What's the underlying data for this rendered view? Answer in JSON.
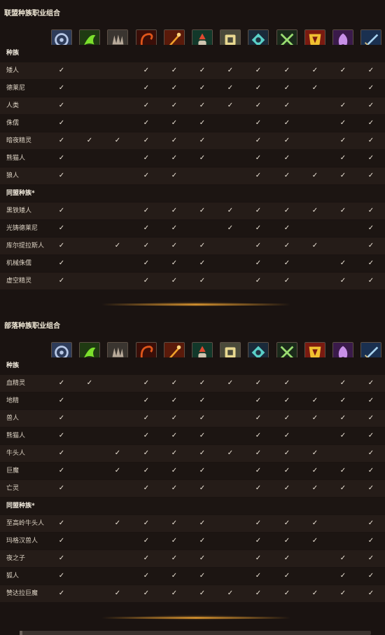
{
  "alliance": {
    "title": "联盟种族职业组合",
    "column_header": "种族",
    "allied_header": "同盟种族*",
    "races": [
      {
        "name": "矮人",
        "checks": [
          1,
          0,
          0,
          1,
          1,
          1,
          1,
          1,
          1,
          1,
          1,
          1
        ]
      },
      {
        "name": "德莱尼",
        "checks": [
          1,
          0,
          0,
          1,
          1,
          1,
          1,
          1,
          1,
          1,
          0,
          1
        ]
      },
      {
        "name": "人类",
        "checks": [
          1,
          0,
          0,
          1,
          1,
          1,
          1,
          1,
          1,
          0,
          1,
          1
        ]
      },
      {
        "name": "侏儒",
        "checks": [
          1,
          0,
          0,
          1,
          1,
          1,
          0,
          1,
          1,
          0,
          1,
          1
        ]
      },
      {
        "name": "暗夜精灵",
        "checks": [
          1,
          1,
          1,
          1,
          1,
          1,
          0,
          1,
          1,
          0,
          1,
          1
        ]
      },
      {
        "name": "熊猫人",
        "checks": [
          1,
          0,
          0,
          1,
          1,
          1,
          0,
          1,
          1,
          0,
          1,
          1
        ]
      },
      {
        "name": "狼人",
        "checks": [
          1,
          0,
          0,
          1,
          1,
          0,
          0,
          1,
          1,
          1,
          1,
          1
        ]
      }
    ],
    "allied_races": [
      {
        "name": "黑铁矮人",
        "checks": [
          1,
          0,
          0,
          1,
          1,
          1,
          1,
          1,
          1,
          1,
          1,
          1
        ]
      },
      {
        "name": "光铸德莱尼",
        "checks": [
          1,
          0,
          0,
          1,
          1,
          0,
          1,
          1,
          1,
          0,
          0,
          1
        ]
      },
      {
        "name": "库尔提拉斯人",
        "checks": [
          1,
          0,
          1,
          1,
          1,
          1,
          0,
          1,
          1,
          1,
          0,
          1
        ]
      },
      {
        "name": "机械侏儒",
        "checks": [
          1,
          0,
          0,
          1,
          1,
          1,
          0,
          1,
          1,
          0,
          1,
          1
        ]
      },
      {
        "name": "虚空精灵",
        "checks": [
          1,
          0,
          0,
          1,
          1,
          1,
          0,
          1,
          1,
          0,
          1,
          1
        ]
      }
    ]
  },
  "horde": {
    "title": "部落种族职业组合",
    "column_header": "种族",
    "allied_header": "同盟种族*",
    "races": [
      {
        "name": "血精灵",
        "checks": [
          1,
          1,
          0,
          1,
          1,
          1,
          1,
          1,
          1,
          0,
          1,
          1
        ]
      },
      {
        "name": "地精",
        "checks": [
          1,
          0,
          0,
          1,
          1,
          1,
          0,
          1,
          1,
          1,
          1,
          1
        ]
      },
      {
        "name": "兽人",
        "checks": [
          1,
          0,
          0,
          1,
          1,
          1,
          0,
          1,
          1,
          1,
          1,
          1
        ]
      },
      {
        "name": "熊猫人",
        "checks": [
          1,
          0,
          0,
          1,
          1,
          1,
          0,
          1,
          1,
          0,
          1,
          1
        ]
      },
      {
        "name": "牛头人",
        "checks": [
          1,
          0,
          1,
          1,
          1,
          1,
          1,
          1,
          1,
          1,
          0,
          1
        ]
      },
      {
        "name": "巨魔",
        "checks": [
          1,
          0,
          1,
          1,
          1,
          1,
          0,
          1,
          1,
          1,
          1,
          1
        ]
      },
      {
        "name": "亡灵",
        "checks": [
          1,
          0,
          0,
          1,
          1,
          1,
          0,
          1,
          1,
          1,
          1,
          1
        ]
      }
    ],
    "allied_races": [
      {
        "name": "至高岭牛头人",
        "checks": [
          1,
          0,
          1,
          1,
          1,
          1,
          0,
          1,
          1,
          1,
          0,
          1
        ]
      },
      {
        "name": "玛格汉兽人",
        "checks": [
          1,
          0,
          0,
          1,
          1,
          1,
          0,
          1,
          1,
          1,
          0,
          1
        ]
      },
      {
        "name": "夜之子",
        "checks": [
          1,
          0,
          0,
          1,
          1,
          1,
          0,
          1,
          1,
          0,
          1,
          1
        ]
      },
      {
        "name": "狐人",
        "checks": [
          1,
          0,
          0,
          1,
          1,
          1,
          0,
          1,
          1,
          0,
          1,
          1
        ]
      },
      {
        "name": "赞达拉巨魔",
        "checks": [
          1,
          0,
          1,
          1,
          1,
          1,
          1,
          1,
          1,
          1,
          1,
          1
        ]
      }
    ]
  },
  "check_symbol": "✓",
  "class_icons": [
    {
      "name": "death-knight-icon",
      "bg": "#2e3c5a",
      "fg": "#b8c8e6"
    },
    {
      "name": "demon-hunter-icon",
      "bg": "#1f3a12",
      "fg": "#7be02c"
    },
    {
      "name": "druid-icon",
      "bg": "#3a3530",
      "fg": "#b8aa9a"
    },
    {
      "name": "evoker-icon",
      "bg": "#3a0e08",
      "fg": "#e0561a"
    },
    {
      "name": "hunter-icon",
      "bg": "#5a1a0a",
      "fg": "#f0a02a"
    },
    {
      "name": "mage-icon",
      "bg": "#12382a",
      "fg": "#e04a30"
    },
    {
      "name": "monk-icon",
      "bg": "#4a4a3a",
      "fg": "#e8d890"
    },
    {
      "name": "paladin-icon",
      "bg": "#1a2a3a",
      "fg": "#5ad0c8"
    },
    {
      "name": "priest-icon",
      "bg": "#1a2a1a",
      "fg": "#9adc70"
    },
    {
      "name": "rogue-icon",
      "bg": "#7a1a10",
      "fg": "#f0c030"
    },
    {
      "name": "shaman-icon",
      "bg": "#3a1a4a",
      "fg": "#c890e8"
    },
    {
      "name": "warrior-icon",
      "bg": "#1a3050",
      "fg": "#a8d4f0"
    }
  ]
}
